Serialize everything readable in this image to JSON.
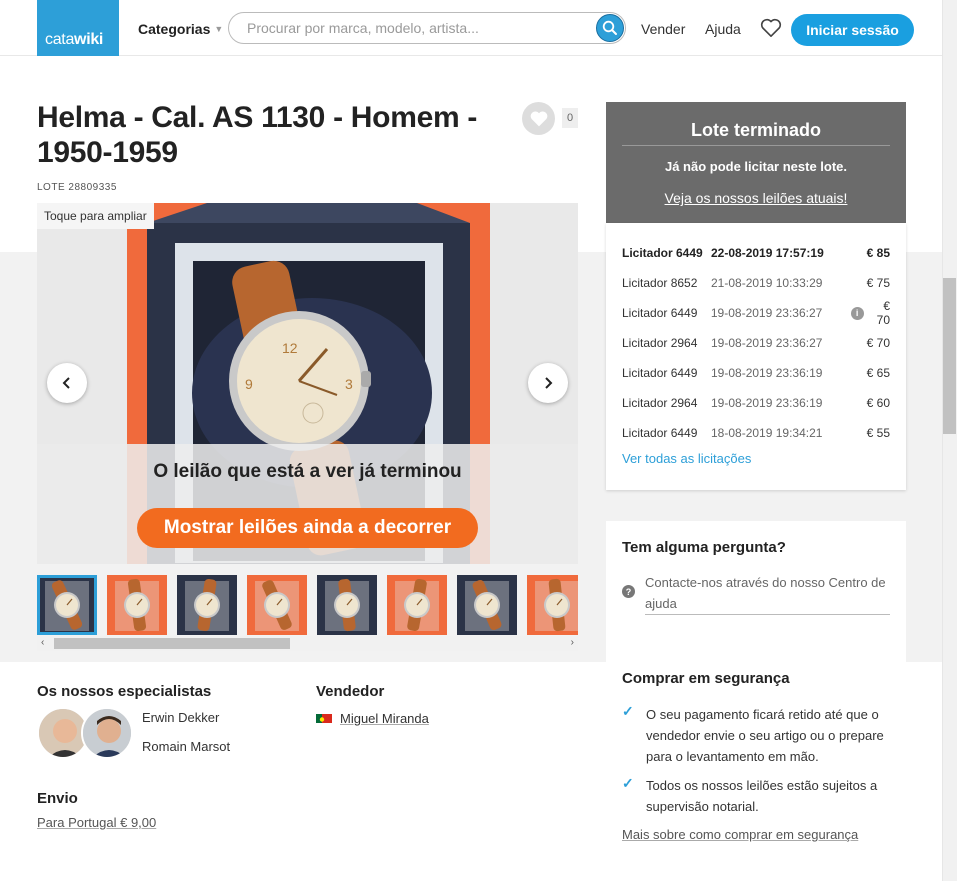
{
  "header": {
    "logo_part1": "cata",
    "logo_part2": "wiki",
    "categories_label": "Categorias",
    "search_placeholder": "Procurar por marca, modelo, artista...",
    "sell_label": "Vender",
    "help_label": "Ajuda",
    "login_label": "Iniciar sessão"
  },
  "lot": {
    "title": "Helma - Cal. AS 1130 - Homem - 1950-1959",
    "lot_number": "LOTE 28809335",
    "favorites_count": "0"
  },
  "gallery": {
    "zoom_hint": "Toque para ampliar",
    "ended_message": "O leilão que está a ver já terminou",
    "show_button": "Mostrar leilões ainda a decorrer",
    "thumbnail_count": 8,
    "selected_thumbnail": 1,
    "scroll_left": "‹",
    "scroll_right": "›"
  },
  "experts": {
    "heading": "Os nossos especialistas",
    "names": [
      "Erwin Dekker",
      "Romain Marsot"
    ]
  },
  "seller": {
    "heading": "Vendedor",
    "name": "Miguel Miranda",
    "country_flag": "portugal-flag"
  },
  "shipping": {
    "heading": "Envio",
    "link": "Para Portugal € 9,00"
  },
  "status_box": {
    "title": "Lote terminado",
    "subtitle": "Já não pode licitar neste lote.",
    "link": "Veja os nossos leilões atuais!"
  },
  "bids": {
    "rows": [
      {
        "bidder": "Licitador 6449",
        "time": "22-08-2019 17:57:19",
        "amount": "€ 85",
        "info": false
      },
      {
        "bidder": "Licitador 8652",
        "time": "21-08-2019 10:33:29",
        "amount": "€ 75",
        "info": false
      },
      {
        "bidder": "Licitador 6449",
        "time": "19-08-2019 23:36:27",
        "amount": "€ 70",
        "info": true
      },
      {
        "bidder": "Licitador 2964",
        "time": "19-08-2019 23:36:27",
        "amount": "€ 70",
        "info": false
      },
      {
        "bidder": "Licitador 6449",
        "time": "19-08-2019 23:36:19",
        "amount": "€ 65",
        "info": false
      },
      {
        "bidder": "Licitador 2964",
        "time": "19-08-2019 23:36:19",
        "amount": "€ 60",
        "info": false
      },
      {
        "bidder": "Licitador 6449",
        "time": "18-08-2019 19:34:21",
        "amount": "€ 55",
        "info": false
      }
    ],
    "all_link": "Ver todas as licitações"
  },
  "questions": {
    "heading": "Tem alguma pergunta?",
    "text": "Contacte-nos através do nosso Centro de ajuda"
  },
  "safe_buying": {
    "heading": "Comprar em segurança",
    "items": [
      "O seu pagamento ficará retido até que o vendedor envie o seu artigo ou o prepare para o levantamento em mão.",
      "Todos os nossos leilões estão sujeitos a supervisão notarial."
    ],
    "link": "Mais sobre como comprar em segurança"
  },
  "colors": {
    "brand_blue": "#2d9fd8",
    "cta_orange": "#f26b1f",
    "status_gray": "#6b6b6b"
  }
}
